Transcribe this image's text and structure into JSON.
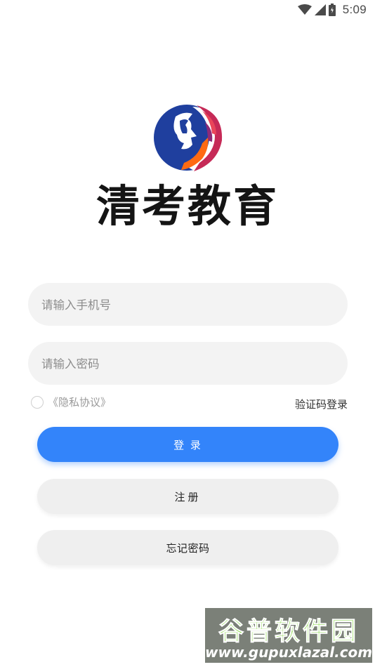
{
  "status_bar": {
    "time": "5:09",
    "icons": [
      "wifi-icon",
      "signal-icon",
      "battery-icon"
    ]
  },
  "app": {
    "title": "清考教育",
    "logo": "lion-logo"
  },
  "login_form": {
    "phone_placeholder": "请输入手机号",
    "password_placeholder": "请输入密码",
    "privacy_label": "《隐私协议》",
    "sms_login_label": "验证码登录",
    "login_button": "登 录",
    "register_button": "注册",
    "forgot_button": "忘记密码"
  },
  "watermark": {
    "title": "谷普软件园",
    "url": "www.gupuxlazal.com"
  },
  "colors": {
    "primary": "#3384fa",
    "input_bg": "#f3f3f3",
    "secondary_bg": "#efefef"
  }
}
